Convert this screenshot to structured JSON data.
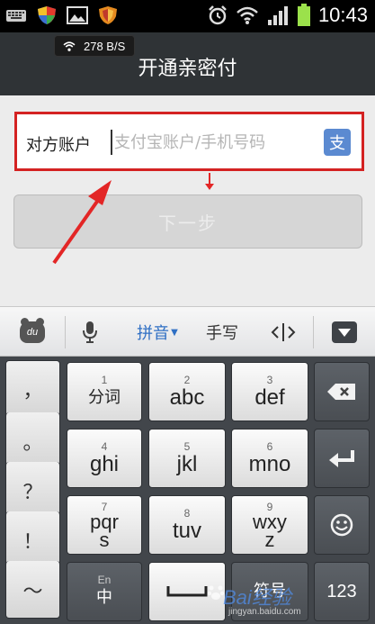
{
  "status_bar": {
    "time": "10:43",
    "left_icons": [
      "keyboard-icon",
      "shield-icon",
      "image-icon",
      "shield-app-icon"
    ],
    "right_icons": [
      "alarm-icon",
      "wifi-icon",
      "signal-icon",
      "battery-icon"
    ],
    "net_speed": "278 B/S"
  },
  "titlebar": {
    "title": "开通亲密付"
  },
  "form": {
    "account_label": "对方账户",
    "account_placeholder": "支付宝账户/手机号码",
    "alipay_glyph": "支",
    "next_button": "下一步",
    "highlight_color": "#d42222"
  },
  "keyboard_toolbar": {
    "du_logo": "du",
    "pinyin_label": "拼音",
    "handwriting_label": "手写"
  },
  "keyboard": {
    "side_keys": [
      "，",
      "。",
      "？",
      "！",
      "～"
    ],
    "keys": [
      {
        "num": "1",
        "label": "分词"
      },
      {
        "num": "2",
        "label": "abc"
      },
      {
        "num": "3",
        "label": "def"
      },
      {
        "num": "4",
        "label": "ghi"
      },
      {
        "num": "5",
        "label": "jkl"
      },
      {
        "num": "6",
        "label": "mno"
      },
      {
        "num": "7",
        "label1": "pqr",
        "label2": "s"
      },
      {
        "num": "8",
        "label": "tuv"
      },
      {
        "num": "9",
        "label1": "wxy",
        "label2": "z"
      }
    ],
    "lang_key_small": "En",
    "lang_key_main": "中",
    "symbol_key": "符号",
    "num_key": "123"
  },
  "watermark": {
    "main": "Bai经验",
    "sub": "jingyan.baidu.com"
  }
}
